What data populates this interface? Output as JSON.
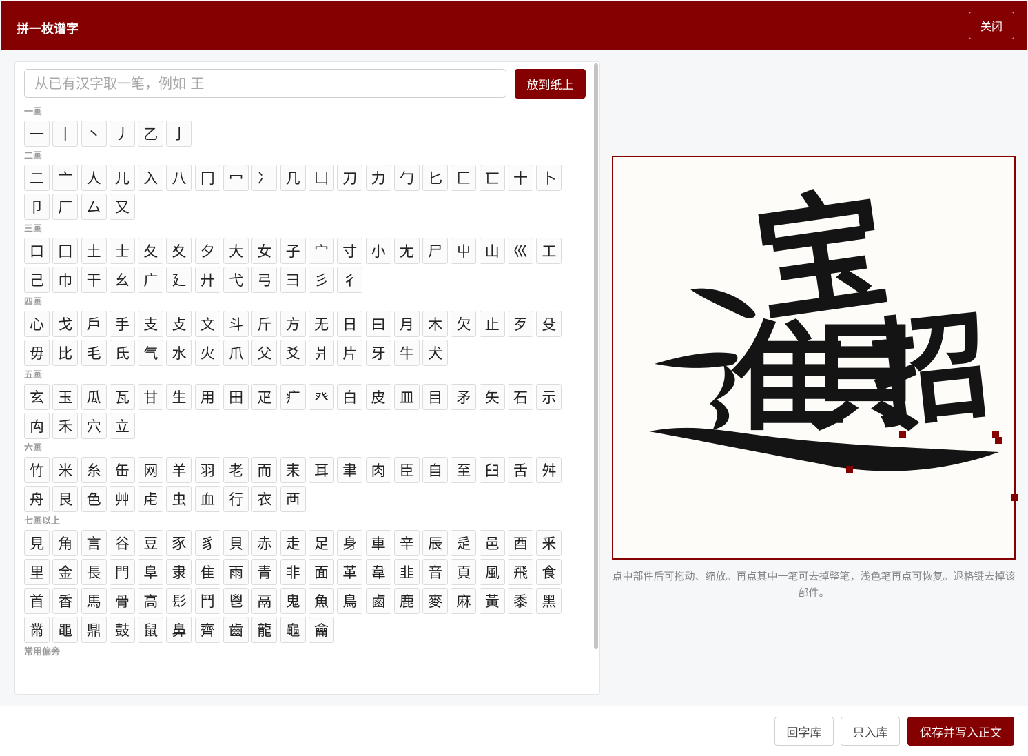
{
  "header": {
    "title": "拼一枚谱字",
    "close_label": "关闭"
  },
  "search": {
    "placeholder": "从已有汉字取一笔，例如 王",
    "place_label": "放到纸上"
  },
  "groups": [
    {
      "label": "一画",
      "chars": [
        "一",
        "丨",
        "丶",
        "丿",
        "乙",
        "亅"
      ]
    },
    {
      "label": "二画",
      "chars": [
        "二",
        "亠",
        "人",
        "儿",
        "入",
        "八",
        "冂",
        "冖",
        "冫",
        "几",
        "凵",
        "刀",
        "力",
        "勹",
        "匕",
        "匚",
        "匸",
        "十",
        "卜",
        "卩",
        "厂",
        "厶",
        "又"
      ]
    },
    {
      "label": "三画",
      "chars": [
        "口",
        "囗",
        "土",
        "士",
        "夂",
        "夊",
        "夕",
        "大",
        "女",
        "子",
        "宀",
        "寸",
        "小",
        "尢",
        "尸",
        "屮",
        "山",
        "巛",
        "工",
        "己",
        "巾",
        "干",
        "幺",
        "广",
        "廴",
        "廾",
        "弋",
        "弓",
        "彐",
        "彡",
        "彳"
      ]
    },
    {
      "label": "四画",
      "chars": [
        "心",
        "戈",
        "戶",
        "手",
        "支",
        "攴",
        "文",
        "斗",
        "斤",
        "方",
        "无",
        "日",
        "曰",
        "月",
        "木",
        "欠",
        "止",
        "歹",
        "殳",
        "毋",
        "比",
        "毛",
        "氏",
        "气",
        "水",
        "火",
        "爪",
        "父",
        "爻",
        "爿",
        "片",
        "牙",
        "牛",
        "犬"
      ]
    },
    {
      "label": "五画",
      "chars": [
        "玄",
        "玉",
        "瓜",
        "瓦",
        "甘",
        "生",
        "用",
        "田",
        "疋",
        "疒",
        "癶",
        "白",
        "皮",
        "皿",
        "目",
        "矛",
        "矢",
        "石",
        "示",
        "禸",
        "禾",
        "穴",
        "立"
      ]
    },
    {
      "label": "六画",
      "chars": [
        "竹",
        "米",
        "糸",
        "缶",
        "网",
        "羊",
        "羽",
        "老",
        "而",
        "耒",
        "耳",
        "聿",
        "肉",
        "臣",
        "自",
        "至",
        "臼",
        "舌",
        "舛",
        "舟",
        "艮",
        "色",
        "艸",
        "虍",
        "虫",
        "血",
        "行",
        "衣",
        "襾"
      ]
    },
    {
      "label": "七画以上",
      "chars": [
        "見",
        "角",
        "言",
        "谷",
        "豆",
        "豕",
        "豸",
        "貝",
        "赤",
        "走",
        "足",
        "身",
        "車",
        "辛",
        "辰",
        "辵",
        "邑",
        "酉",
        "釆",
        "里",
        "金",
        "長",
        "門",
        "阜",
        "隶",
        "隹",
        "雨",
        "青",
        "非",
        "面",
        "革",
        "韋",
        "韭",
        "音",
        "頁",
        "風",
        "飛",
        "食",
        "首",
        "香",
        "馬",
        "骨",
        "高",
        "髟",
        "鬥",
        "鬯",
        "鬲",
        "鬼",
        "魚",
        "鳥",
        "鹵",
        "鹿",
        "麥",
        "麻",
        "黃",
        "黍",
        "黑",
        "黹",
        "黽",
        "鼎",
        "鼓",
        "鼠",
        "鼻",
        "齊",
        "齒",
        "龍",
        "龜",
        "龠"
      ]
    },
    {
      "label": "常用偏旁",
      "chars": []
    }
  ],
  "canvas": {
    "composed_chars": [
      "宝",
      "缶",
      "隹",
      "貝",
      "招"
    ]
  },
  "hint": "点中部件后可拖动、缩放。再点其中一笔可去掉整笔，浅色笔再点可恢复。退格键去掉该部件。",
  "footer": {
    "back_label": "回字库",
    "save_only_label": "只入库",
    "save_write_label": "保存并写入正文"
  },
  "colors": {
    "accent": "#850000",
    "ink": "#141414"
  }
}
